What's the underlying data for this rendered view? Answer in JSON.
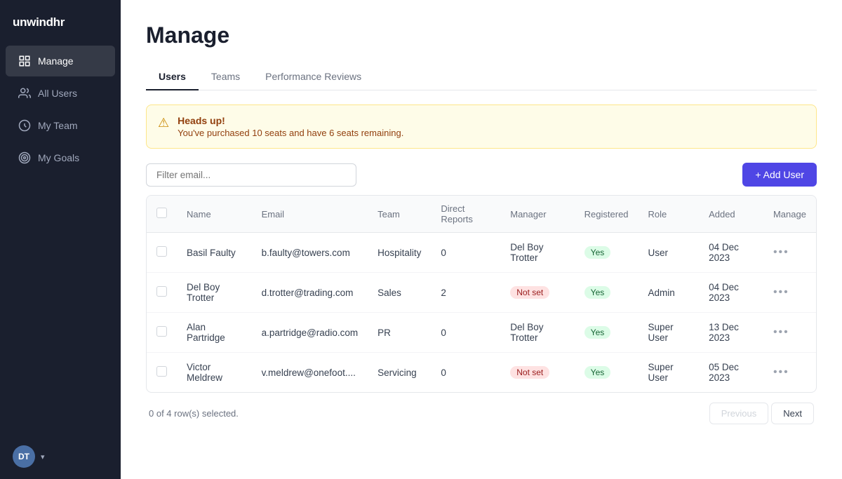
{
  "app": {
    "name": "unwindhr"
  },
  "sidebar": {
    "nav_items": [
      {
        "id": "manage",
        "label": "Manage",
        "icon": "grid",
        "active": true
      },
      {
        "id": "all-users",
        "label": "All Users",
        "icon": "users",
        "active": false
      },
      {
        "id": "my-team",
        "label": "My Team",
        "icon": "team",
        "active": false
      },
      {
        "id": "my-goals",
        "label": "My Goals",
        "icon": "target",
        "active": false
      }
    ],
    "footer": {
      "initials": "DT",
      "chevron": "▾"
    }
  },
  "page": {
    "title": "Manage"
  },
  "tabs": [
    {
      "id": "users",
      "label": "Users",
      "active": true
    },
    {
      "id": "teams",
      "label": "Teams",
      "active": false
    },
    {
      "id": "performance-reviews",
      "label": "Performance Reviews",
      "active": false
    }
  ],
  "alert": {
    "title": "Heads up!",
    "text": "You've purchased 10 seats and have 6 seats remaining."
  },
  "toolbar": {
    "filter_placeholder": "Filter email...",
    "add_user_label": "+ Add User"
  },
  "table": {
    "columns": [
      "",
      "Name",
      "Email",
      "Team",
      "Direct Reports",
      "Manager",
      "Registered",
      "Role",
      "Added",
      "Manage"
    ],
    "rows": [
      {
        "name": "Basil Faulty",
        "email": "b.faulty@towers.com",
        "team": "Hospitality",
        "direct_reports": "0",
        "manager": "Del Boy Trotter",
        "manager_badge": "yes",
        "registered": "Yes",
        "registered_badge": "yes",
        "role": "User",
        "added": "04 Dec 2023"
      },
      {
        "name": "Del Boy Trotter",
        "email": "d.trotter@trading.com",
        "team": "Sales",
        "direct_reports": "2",
        "manager": "Not set",
        "manager_badge": "notset",
        "registered": "Yes",
        "registered_badge": "yes",
        "role": "Admin",
        "added": "04 Dec 2023"
      },
      {
        "name": "Alan Partridge",
        "email": "a.partridge@radio.com",
        "team": "PR",
        "direct_reports": "0",
        "manager": "Del Boy Trotter",
        "manager_badge": "yes",
        "registered": "Yes",
        "registered_badge": "yes",
        "role": "Super User",
        "added": "13 Dec 2023"
      },
      {
        "name": "Victor Meldrew",
        "email": "v.meldrew@onefoot....",
        "team": "Servicing",
        "direct_reports": "0",
        "manager": "Not set",
        "manager_badge": "notset",
        "registered": "Yes",
        "registered_badge": "yes",
        "role": "Super User",
        "added": "05 Dec 2023"
      }
    ]
  },
  "pagination": {
    "selection_text": "0 of 4 row(s) selected.",
    "previous_label": "Previous",
    "next_label": "Next"
  }
}
